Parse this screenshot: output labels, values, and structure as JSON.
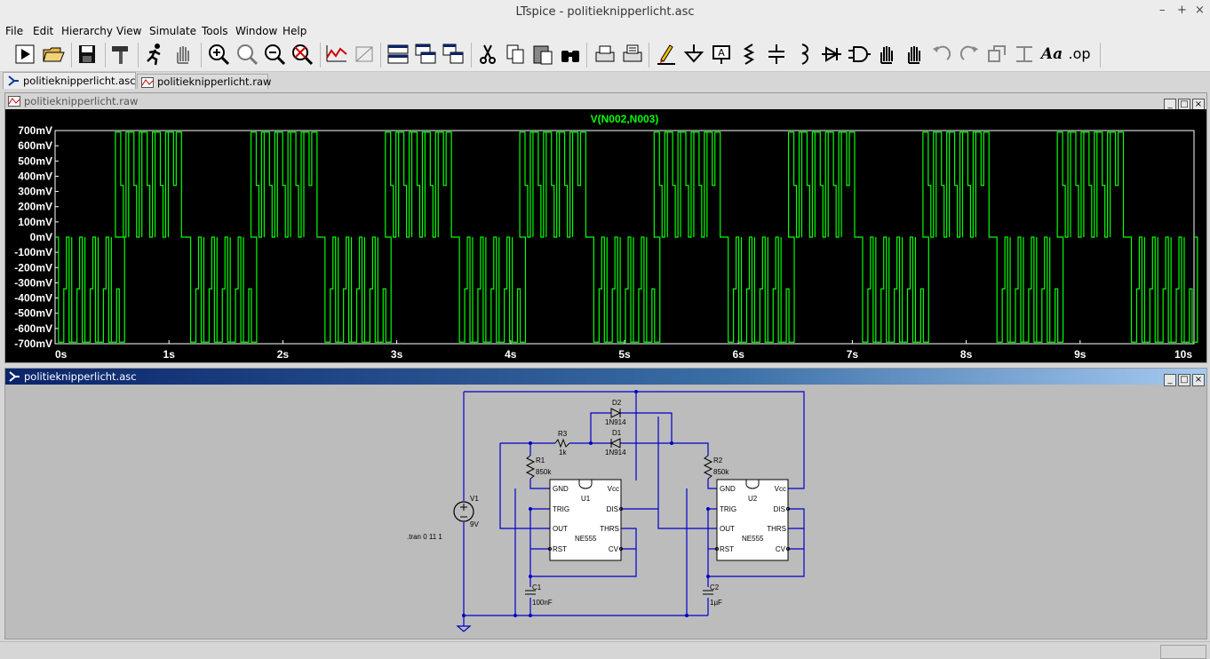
{
  "window": {
    "title": "LTspice - politieknipperlicht.asc"
  },
  "menu": [
    "File",
    "Edit",
    "Hierarchy",
    "View",
    "Simulate",
    "Tools",
    "Window",
    "Help"
  ],
  "toolbar": {
    "icons": [
      "run-icon",
      "open-icon",
      "save-icon",
      "hammer-icon",
      "run-man-icon",
      "pan-hand-icon",
      "zoom-in-icon",
      "zoom-area-icon",
      "zoom-out-icon",
      "zoom-cancel-icon",
      "autorange-icon",
      "measure-icon",
      "tile-horizontal-icon",
      "cascade-icon",
      "tile-vertical-icon",
      "cut-icon",
      "copy-icon",
      "paste-icon",
      "find-icon",
      "print-setup-icon",
      "print-icon",
      "pencil-wire-icon",
      "ground-icon",
      "label-icon",
      "resistor-icon",
      "capacitor-icon",
      "inductor-icon",
      "diode-icon",
      "component-icon",
      "move-icon",
      "drag-icon",
      "undo-icon",
      "redo-icon",
      "rotate-icon",
      "mirror-icon",
      "text-icon",
      "spice-directive-icon"
    ],
    "text_label": "Aa",
    "op_label": ".op"
  },
  "tabs": [
    {
      "label": "politieknipperlicht.asc",
      "active": true
    },
    {
      "label": "politieknipperlicht.raw",
      "active": false
    }
  ],
  "plot_window": {
    "title": "politieknipperlicht.raw"
  },
  "schematic_window": {
    "title": "politieknipperlicht.asc"
  },
  "chart_data": {
    "type": "line",
    "trace_name": "V(N002,N003)",
    "color": "#00ff00",
    "x_unit": "s",
    "y_unit": "mV",
    "xlim": [
      0,
      10
    ],
    "ylim": [
      -700,
      700
    ],
    "x_ticks": [
      "0s",
      "1s",
      "2s",
      "3s",
      "4s",
      "5s",
      "6s",
      "7s",
      "8s",
      "9s",
      "10s"
    ],
    "y_ticks": [
      "700mV",
      "600mV",
      "500mV",
      "400mV",
      "300mV",
      "200mV",
      "100mV",
      "0mV",
      "-100mV",
      "-200mV",
      "-300mV",
      "-400mV",
      "-500mV",
      "-600mV",
      "-700mV"
    ],
    "high_level": 690,
    "low_level": -690,
    "mid_high": 340,
    "mid_low": -340,
    "pos_bursts_start": [
      0.53,
      1.72,
      2.9,
      4.08,
      5.26,
      6.44,
      7.62,
      8.8
    ],
    "neg_bursts_start": [
      0.03,
      1.19,
      2.37,
      3.55,
      4.73,
      5.91,
      7.09,
      8.27,
      9.45
    ],
    "burst_length": 0.58,
    "pulses_per_burst": 5
  },
  "schematic": {
    "components": {
      "V1": {
        "name": "V1",
        "value": "9V"
      },
      "R1": {
        "name": "R1",
        "value": "850k"
      },
      "R2": {
        "name": "R2",
        "value": "850k"
      },
      "R3": {
        "name": "R3",
        "value": "1k"
      },
      "C1": {
        "name": "C1",
        "value": "100nF"
      },
      "C2": {
        "name": "C2",
        "value": "1µF"
      },
      "D1": {
        "name": "D1",
        "value": "1N914"
      },
      "D2": {
        "name": "D2",
        "value": "1N914"
      },
      "U1": {
        "name": "U1",
        "value": "NE555"
      },
      "U2": {
        "name": "U2",
        "value": "NE555"
      }
    },
    "pins": {
      "gnd": "GND",
      "vcc": "Vcc",
      "trig": "TRIG",
      "dis": "DIS",
      "out": "OUT",
      "thrs": "THRS",
      "rst": "RST",
      "cv": "CV"
    },
    "directive": ".tran 0 11 1"
  }
}
